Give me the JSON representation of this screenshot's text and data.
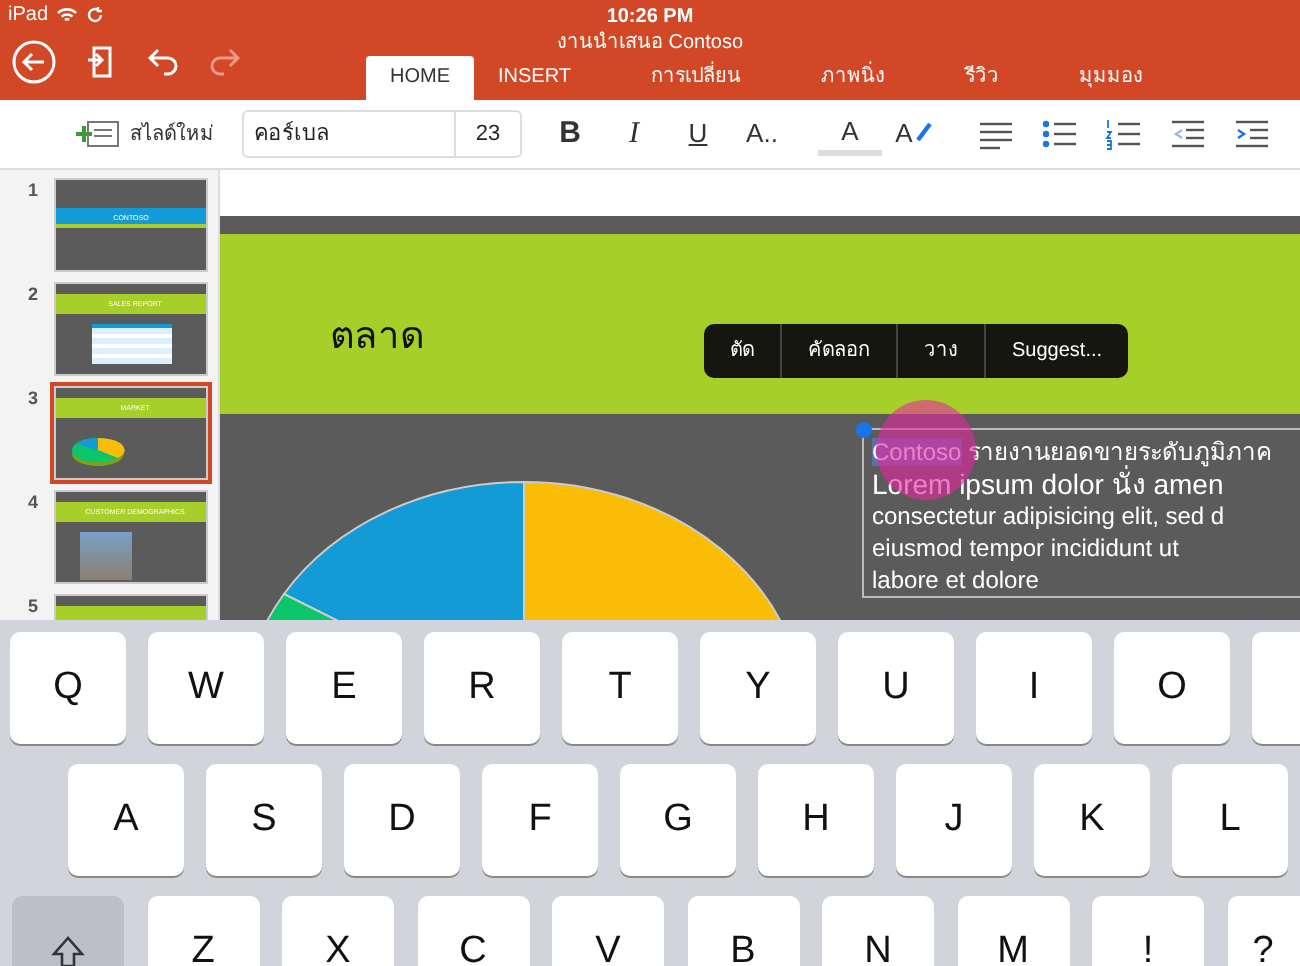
{
  "status_bar": {
    "device": "iPad",
    "time": "10:26 PM"
  },
  "document_title": "งานนำเสนอ Contoso",
  "tabs": [
    {
      "label": "HOME",
      "selected": true
    },
    {
      "label": "INSERT",
      "selected": false
    },
    {
      "label": "การเปลี่ยน",
      "selected": false
    },
    {
      "label": "ภาพนิ่ง",
      "selected": false
    },
    {
      "label": "รีวิว",
      "selected": false
    },
    {
      "label": "มุมมอง",
      "selected": false
    }
  ],
  "ribbon": {
    "new_slide": "สไลด์ใหม่",
    "font_name": "คอร์เบล",
    "font_size": "23"
  },
  "format_buttons": [
    {
      "kind": "bold",
      "label": "B"
    },
    {
      "kind": "italic",
      "label": "I"
    },
    {
      "kind": "underline",
      "label": "U"
    },
    {
      "kind": "font",
      "label": "A.."
    },
    {
      "kind": "color",
      "label": "A"
    },
    {
      "kind": "highlight",
      "label": "A"
    },
    {
      "kind": "align"
    },
    {
      "kind": "bullets"
    },
    {
      "kind": "numbering"
    },
    {
      "kind": "outdent"
    },
    {
      "kind": "indent"
    }
  ],
  "slides": [
    {
      "number": "1",
      "kind": "title",
      "title": "CONTOSO",
      "selected": false
    },
    {
      "number": "2",
      "kind": "table",
      "title": "SALES REPORT",
      "selected": false
    },
    {
      "number": "3",
      "kind": "chart",
      "title": "MARKET",
      "selected": true
    },
    {
      "number": "4",
      "kind": "photo",
      "title": "CUSTOMER DEMOGRAPHICS",
      "selected": false
    },
    {
      "number": "5",
      "kind": "blank",
      "selected": false
    }
  ],
  "slide": {
    "title": "ตลาด",
    "context_menu": [
      "ตัด",
      "คัดลอก",
      "วาง",
      "Suggest..."
    ],
    "text_box": {
      "selected_text": "Contoso",
      "heading_rest": "รายงานยอดขายระดับภูมิภาค",
      "lines": [
        "Lorem ipsum dolor นั่ง amen",
        "consectetur adipisicing elit, sed d",
        "eiusmod tempor incididunt ut",
        "labore et dolore"
      ]
    }
  },
  "keyboard": {
    "rows": [
      [
        {
          "kind": "letter",
          "label": "Q"
        },
        {
          "kind": "letter",
          "label": "W"
        },
        {
          "kind": "letter",
          "label": "E"
        },
        {
          "kind": "letter",
          "label": "R"
        },
        {
          "kind": "letter",
          "label": "T"
        },
        {
          "kind": "letter",
          "label": "Y"
        },
        {
          "kind": "letter",
          "label": "U"
        },
        {
          "kind": "letter",
          "label": "I"
        },
        {
          "kind": "letter",
          "label": "O"
        },
        {
          "kind": "blank"
        }
      ],
      [
        {
          "kind": "letter",
          "label": "A"
        },
        {
          "kind": "letter",
          "label": "S"
        },
        {
          "kind": "letter",
          "label": "D"
        },
        {
          "kind": "letter",
          "label": "F"
        },
        {
          "kind": "letter",
          "label": "G"
        },
        {
          "kind": "letter",
          "label": "H"
        },
        {
          "kind": "letter",
          "label": "J"
        },
        {
          "kind": "letter",
          "label": "K"
        },
        {
          "kind": "letter",
          "label": "L"
        }
      ],
      [
        {
          "kind": "shift"
        },
        {
          "kind": "letter",
          "label": "Z"
        },
        {
          "kind": "letter",
          "label": "X"
        },
        {
          "kind": "letter",
          "label": "C"
        },
        {
          "kind": "letter",
          "label": "V"
        },
        {
          "kind": "letter",
          "label": "B"
        },
        {
          "kind": "letter",
          "label": "N"
        },
        {
          "kind": "letter",
          "label": "M"
        },
        {
          "kind": "letter",
          "label": "!"
        },
        {
          "kind": "letter",
          "label": "?"
        }
      ]
    ]
  }
}
